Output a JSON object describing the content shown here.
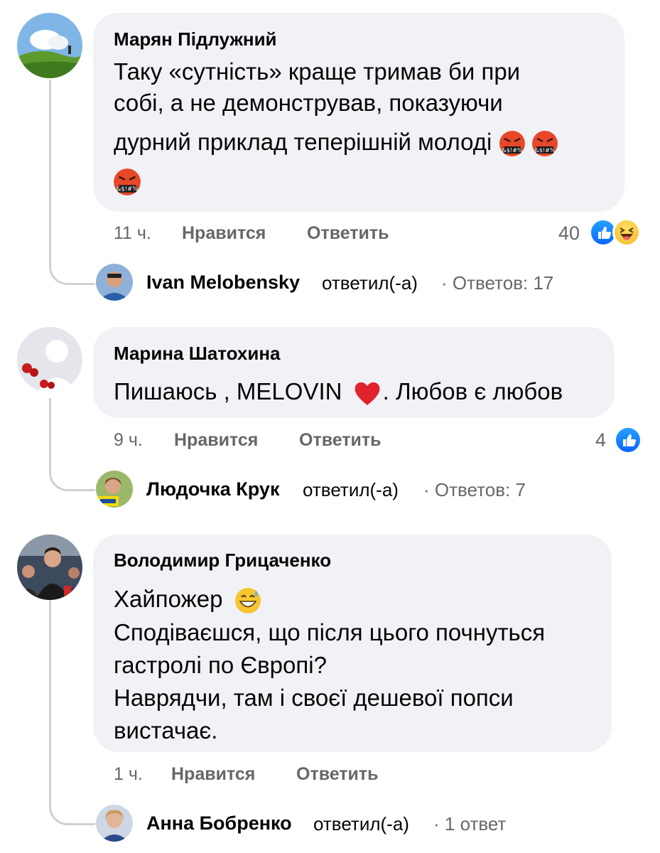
{
  "comments": [
    {
      "author": "Марян Підлужний",
      "lines": [
        "Таку «сутність» краще тримав би при",
        "собі, а не демонстрував, показуючи",
        "дурний приклад теперішній молоді"
      ],
      "emoji": "angry-cursing-face-icon",
      "time": "11 ч.",
      "like_label": "Нравится",
      "reply_label": "Ответить",
      "reaction_count": "40",
      "reactions": [
        "like-icon",
        "haha-icon"
      ],
      "reply_preview": {
        "name": "Ivan Melobensky",
        "verb": "ответил(-а)",
        "count": "· Ответов: 17"
      }
    },
    {
      "author": "Марина Шатохина",
      "text_before": "Пишаюсь , MELOVIN",
      "text_after": ". Любов є любов",
      "emoji": "red-heart-icon",
      "time": "9 ч.",
      "like_label": "Нравится",
      "reply_label": "Ответить",
      "reaction_count": "4",
      "reactions": [
        "like-icon"
      ],
      "reply_preview": {
        "name": "Людочка Крук",
        "verb": "ответил(-а)",
        "count": "· Ответов: 7"
      }
    },
    {
      "author": "Володимир Грицаченко",
      "first_line": "Хайпожер",
      "lines": [
        "Сподіваєшся, що після цього почнуться",
        "гастролі по Європі?",
        "Наврядчи, там і своєї дешевої попси",
        "вистачає."
      ],
      "emoji": "grinning-sweat-face-icon",
      "time": "1 ч.",
      "like_label": "Нравится",
      "reply_label": "Ответить",
      "reply_preview": {
        "name": "Анна Бобренко",
        "verb": "ответил(-а)",
        "count": "· 1 ответ"
      }
    }
  ],
  "colors": {
    "bubble": "#f0f2f5",
    "meta_text": "#65676b",
    "like_blue": "#0866ff",
    "thread_line": "#ced0d4"
  }
}
